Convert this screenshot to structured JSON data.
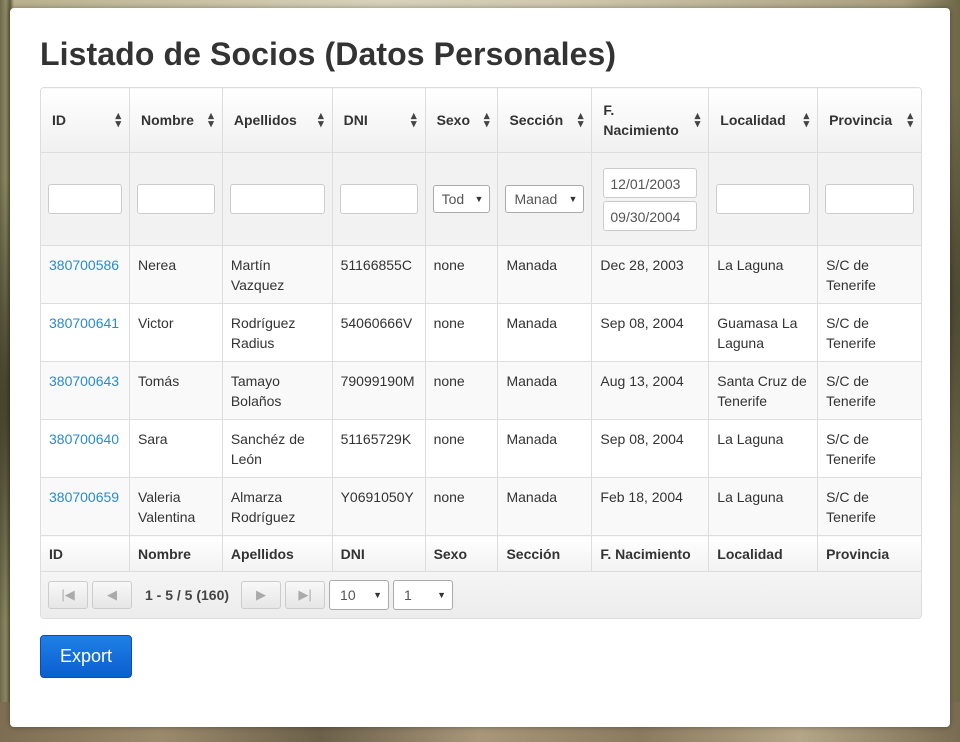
{
  "page_title": "Listado de Socios (Datos Personales)",
  "columns": [
    {
      "label": "ID"
    },
    {
      "label": "Nombre"
    },
    {
      "label": "Apellidos"
    },
    {
      "label": "DNI"
    },
    {
      "label": "Sexo"
    },
    {
      "label": "Sección"
    },
    {
      "label": "F. Nacimiento"
    },
    {
      "label": "Localidad"
    },
    {
      "label": "Provincia"
    }
  ],
  "filters": {
    "sexo_value": "Todos",
    "seccion_value": "Manada",
    "fecha_desde": "12/01/2003",
    "fecha_hasta": "09/30/2004"
  },
  "rows": [
    {
      "id": "380700586",
      "nombre": "Nerea",
      "apellidos": "Martín Vazquez",
      "dni": "51166855C",
      "sexo": "none",
      "seccion": "Manada",
      "nacimiento": "Dec 28, 2003",
      "localidad": "La Laguna",
      "provincia": "S/C de Tenerife"
    },
    {
      "id": "380700641",
      "nombre": "Victor",
      "apellidos": "Rodríguez Radius",
      "dni": "54060666V",
      "sexo": "none",
      "seccion": "Manada",
      "nacimiento": "Sep 08, 2004",
      "localidad": "Guamasa La Laguna",
      "provincia": "S/C de Tenerife"
    },
    {
      "id": "380700643",
      "nombre": "Tomás",
      "apellidos": "Tamayo Bolaños",
      "dni": "79099190M",
      "sexo": "none",
      "seccion": "Manada",
      "nacimiento": "Aug 13, 2004",
      "localidad": "Santa Cruz de Tenerife",
      "provincia": "S/C de Tenerife"
    },
    {
      "id": "380700640",
      "nombre": "Sara",
      "apellidos": "Sanchéz de León",
      "dni": "51165729K",
      "sexo": "none",
      "seccion": "Manada",
      "nacimiento": "Sep 08, 2004",
      "localidad": "La Laguna",
      "provincia": "S/C de Tenerife"
    },
    {
      "id": "380700659",
      "nombre": "Valeria Valentina",
      "apellidos": "Almarza Rodríguez",
      "dni": "Y0691050Y",
      "sexo": "none",
      "seccion": "Manada",
      "nacimiento": "Feb 18, 2004",
      "localidad": "La Laguna",
      "provincia": "S/C de Tenerife"
    }
  ],
  "pager": {
    "info": "1 - 5 / 5 (160)",
    "page_size": "10",
    "page": "1"
  },
  "export_label": "Export",
  "colors": {
    "link": "#2a8bcc",
    "button": "#0b5fd0"
  }
}
